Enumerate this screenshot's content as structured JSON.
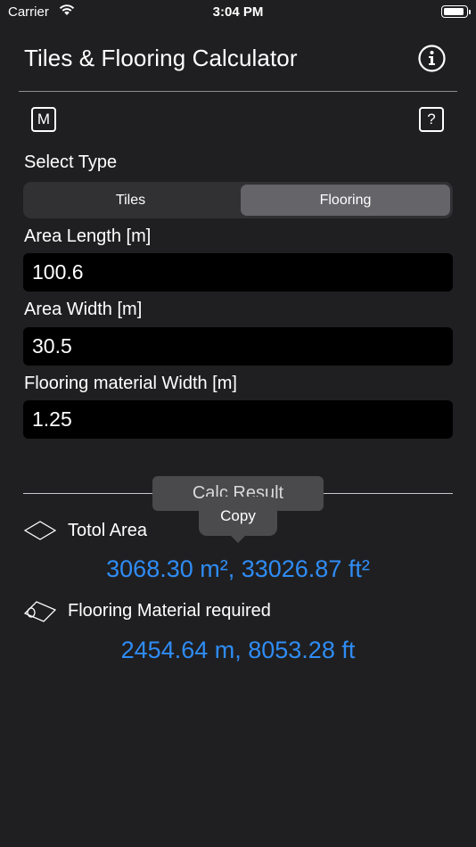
{
  "status_bar": {
    "carrier": "Carrier",
    "time": "3:04 PM",
    "battery_level": 0.95
  },
  "header": {
    "title": "Tiles & Flooring Calculator",
    "info_icon": "info-circle-icon"
  },
  "toolbar": {
    "m_label": "M",
    "help_label": "?"
  },
  "type_select": {
    "label": "Select Type",
    "options": [
      "Tiles",
      "Flooring"
    ],
    "selected": "Flooring"
  },
  "inputs": {
    "length_label": "Area Length [m]",
    "length_value": "100.6",
    "width_label": "Area Width [m]",
    "width_value": "30.5",
    "material_label": "Flooring material Width [m]",
    "material_value": "1.25"
  },
  "result": {
    "button_label": "Calc Result",
    "copy_tooltip": "Copy",
    "area_label": "Totol Area",
    "area_value": "3068.30 m², 33026.87 ft²",
    "material_label": "Flooring Material required",
    "material_value": "2454.64 m, 8053.28 ft",
    "accent_color": "#2f8cf5"
  }
}
